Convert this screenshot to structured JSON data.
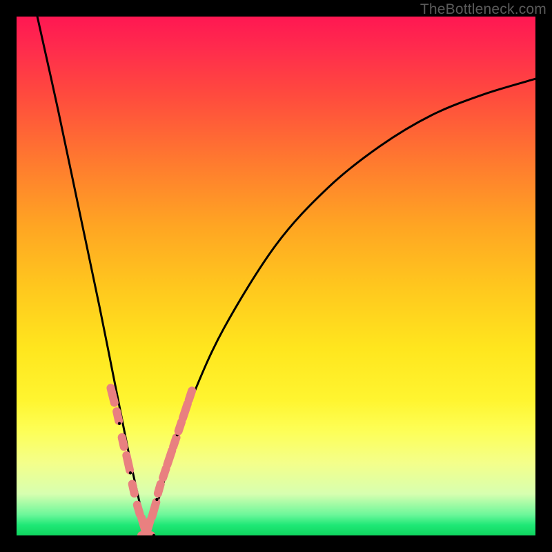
{
  "watermark": "TheBottleneck.com",
  "colors": {
    "frame": "#000000",
    "curve": "#000000",
    "markers": "#e98080",
    "gradient_top": "#ff1752",
    "gradient_bottom": "#0fd55f"
  },
  "chart_data": {
    "type": "line",
    "title": "",
    "xlabel": "",
    "ylabel": "",
    "xlim": [
      0,
      100
    ],
    "ylim": [
      0,
      100
    ],
    "grid": false,
    "legend": false,
    "note": "No axis ticks or numeric labels are visible; values below are estimated from pixel positions on a 0–100 normalized scale (x left→right, y bottom→top). The curve is a V-shaped bottleneck plot dipping to ~0 near x≈25.",
    "series": [
      {
        "name": "bottleneck-curve",
        "x": [
          4,
          8,
          12,
          16,
          20,
          22,
          24,
          25,
          26,
          28,
          30,
          34,
          40,
          50,
          60,
          70,
          80,
          90,
          100
        ],
        "y": [
          100,
          82,
          63,
          44,
          24,
          14,
          5,
          0,
          3,
          9,
          16,
          27,
          40,
          56,
          67,
          75,
          81,
          85,
          88
        ]
      }
    ],
    "markers": {
      "name": "highlighted-points",
      "note": "Salmon colored dash/point clusters along the lower V of the curve",
      "x": [
        18.5,
        19.5,
        20.5,
        21.5,
        22.5,
        23.5,
        24.5,
        25,
        25.5,
        26.5,
        27.5,
        28.5,
        29.5,
        30.5,
        31.5,
        32.5,
        33.5
      ],
      "y": [
        27,
        23,
        18,
        14,
        9,
        5,
        2,
        0,
        2,
        5,
        9,
        12,
        15,
        18,
        21,
        24,
        27
      ]
    }
  }
}
